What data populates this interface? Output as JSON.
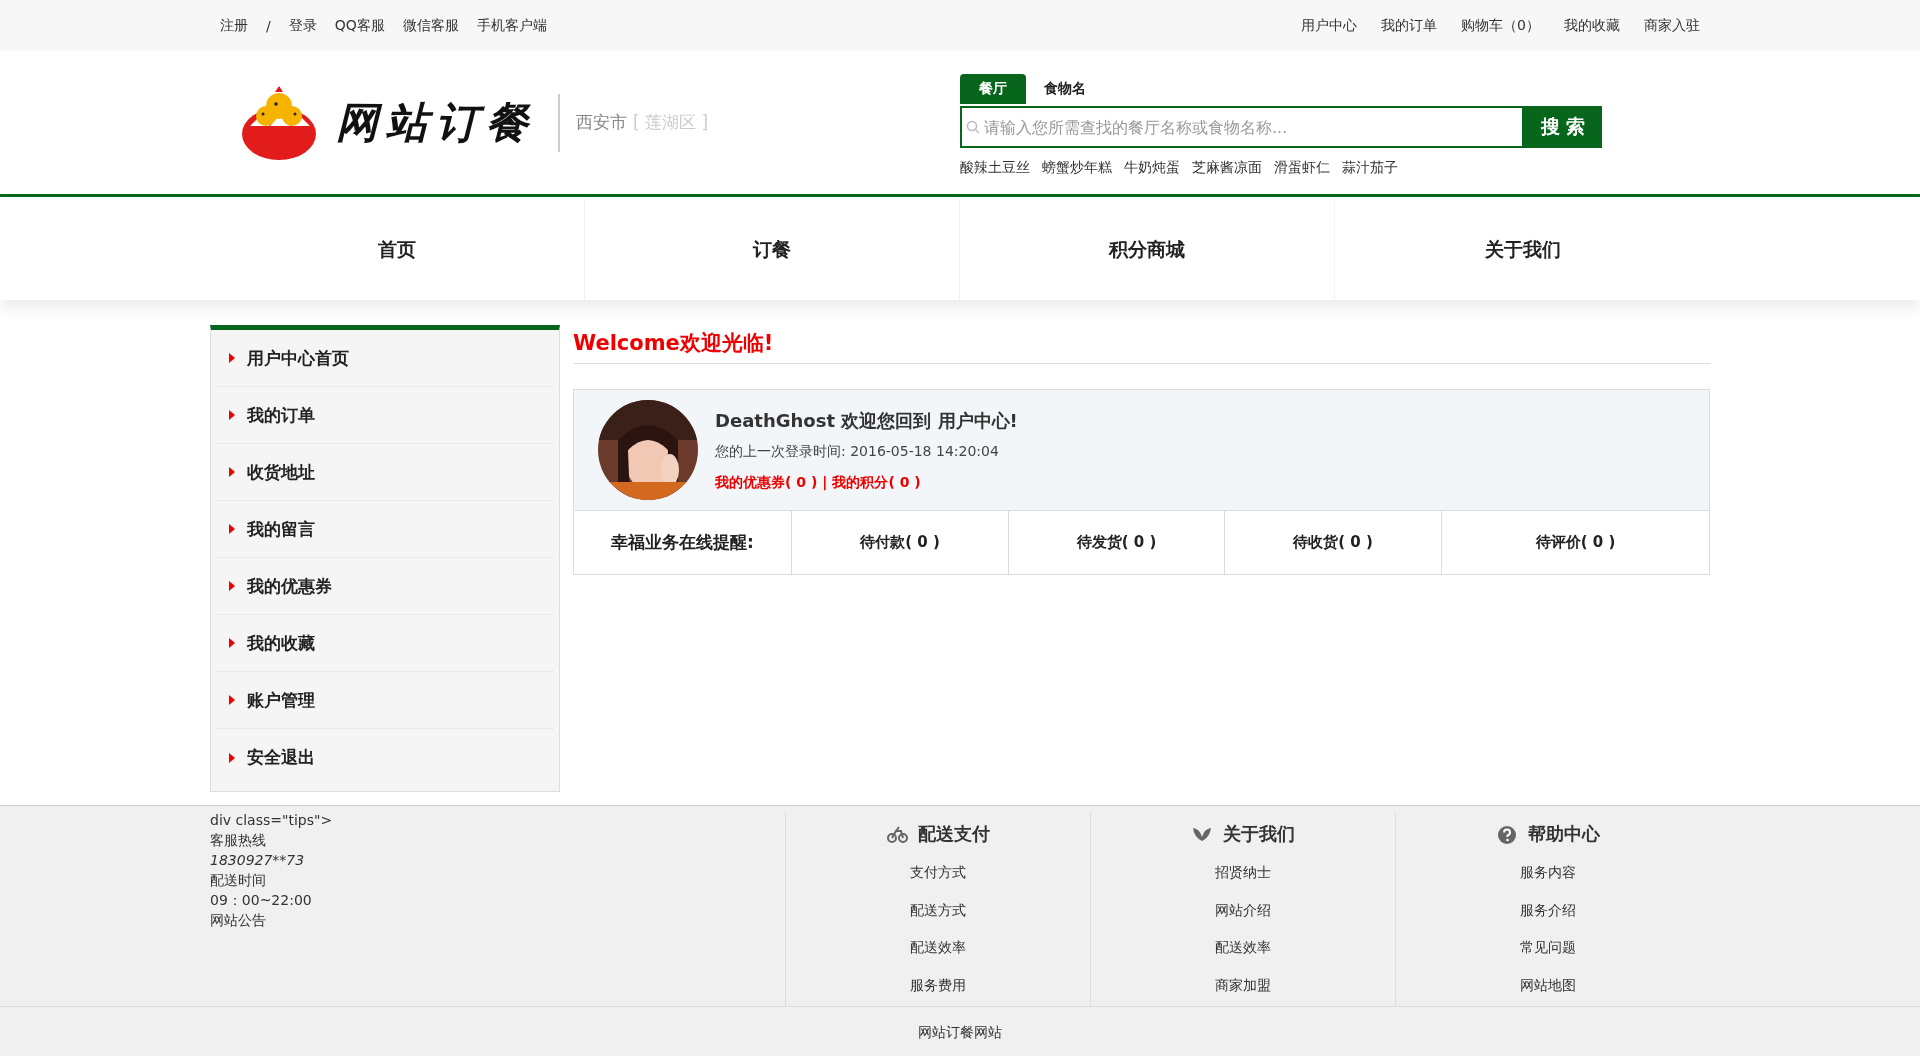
{
  "top_bar": {
    "left_links": [
      "注册",
      "/",
      "登录",
      "QQ客服",
      "微信客服",
      "手机客户端"
    ],
    "right_links": [
      "用户中心",
      "我的订单",
      "购物车（0）",
      "我的收藏",
      "商家入驻"
    ]
  },
  "header": {
    "logo_text": "网站订餐",
    "city": "西安市",
    "district": "[ 莲湖区 ]",
    "search": {
      "tabs": [
        {
          "label": "餐厅",
          "selected": true
        },
        {
          "label": "食物名",
          "selected": false
        }
      ],
      "placeholder": "请输入您所需查找的餐厅名称或食物名称...",
      "button": "搜 索",
      "hot_words": [
        "酸辣土豆丝",
        "螃蟹炒年糕",
        "牛奶炖蛋",
        "芝麻酱凉面",
        "滑蛋虾仁",
        "蒜汁茄子"
      ]
    }
  },
  "nav": [
    "首页",
    "订餐",
    "积分商城",
    "关于我们"
  ],
  "sidebar": {
    "items": [
      "用户中心首页",
      "我的订单",
      "收货地址",
      "我的留言",
      "我的优惠券",
      "我的收藏",
      "账户管理",
      "安全退出"
    ]
  },
  "main": {
    "title": "Welcome欢迎光临!",
    "user": {
      "greeting": "DeathGhost 欢迎您回到 用户中心!",
      "last_login": "您的上一次登录时间: 2016-05-18 14:20:04",
      "coupons": "我的优惠券( 0 )",
      "separator": "|",
      "points": "我的积分( 0 )"
    },
    "reminders": {
      "label": "幸福业务在线提醒:",
      "items": [
        "待付款( 0 )",
        "待发货( 0 )",
        "待收货( 0 )",
        "待评价( 0 )"
      ]
    }
  },
  "footer": {
    "tips": [
      {
        "text": "div class=\"tips\">",
        "italic": false
      },
      {
        "text": "客服热线",
        "italic": false
      },
      {
        "text": "1830927**73",
        "italic": true
      },
      {
        "text": "配送时间",
        "italic": false
      },
      {
        "text": "09：00~22:00",
        "italic": false
      },
      {
        "text": "网站公告",
        "italic": false
      }
    ],
    "columns": [
      {
        "title": "配送支付",
        "links": [
          "支付方式",
          "配送方式",
          "配送效率",
          "服务费用"
        ]
      },
      {
        "title": "关于我们",
        "links": [
          "招贤纳士",
          "网站介绍",
          "配送效率",
          "商家加盟"
        ]
      },
      {
        "title": "帮助中心",
        "links": [
          "服务内容",
          "服务介绍",
          "常见问题",
          "网站地图"
        ]
      }
    ],
    "copyright": "网站订餐网站"
  }
}
